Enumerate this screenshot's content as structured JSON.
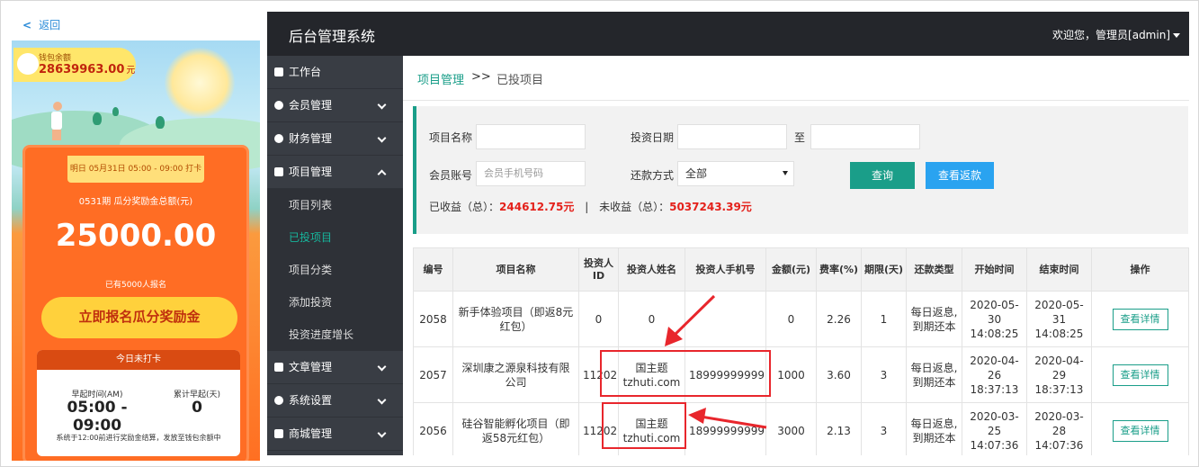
{
  "mobile": {
    "back_label": "返回",
    "wallet": {
      "label": "钱包余额",
      "amount": "28639963.00",
      "unit": "元"
    },
    "checkin_ribbon": "明日 05月31日 05:00 - 09:00 打卡",
    "round_title": "0531期 瓜分奖励金总额(元)",
    "prize_amount": "25000.00",
    "signed_count": "已有5000人报名",
    "cta_label": "立即报名瓜分奖励金",
    "today": {
      "status": "今日未打卡",
      "wake_label": "早起时间(AM)",
      "wake_value": "05:00 - 09:00",
      "total_label": "累计早起(天)",
      "total_value": "0",
      "note": "系统于12:00前进行奖励金结算，发放至钱包余额中"
    }
  },
  "admin": {
    "system_title": "后台管理系统",
    "welcome": "欢迎您，管理员[admin]",
    "sidebar": [
      {
        "label": "工作台",
        "icon": "dashboard-icon",
        "expandable": false
      },
      {
        "label": "会员管理",
        "icon": "members-icon",
        "expandable": true
      },
      {
        "label": "财务管理",
        "icon": "finance-icon",
        "expandable": true
      },
      {
        "label": "项目管理",
        "icon": "project-icon",
        "expandable": true,
        "expanded": true
      }
    ],
    "sidebar_sub": [
      "项目列表",
      "已投项目",
      "项目分类",
      "添加投资",
      "投资进度增长"
    ],
    "sidebar_rest": [
      {
        "label": "文章管理",
        "icon": "article-icon"
      },
      {
        "label": "系统设置",
        "icon": "gear-icon"
      },
      {
        "label": "商城管理",
        "icon": "shop-icon"
      }
    ],
    "breadcrumb": {
      "parent": "项目管理",
      "sep": ">>",
      "current": "已投项目"
    },
    "filter": {
      "project_name_label": "项目名称",
      "invest_date_label": "投资日期",
      "to_label": "至",
      "member_label": "会员账号",
      "member_placeholder": "会员手机号码",
      "repay_label": "还款方式",
      "repay_selected": "全部",
      "query_btn": "查询",
      "view_returns_btn": "查看返款"
    },
    "income": {
      "earned_label": "已收益（总）：",
      "earned_value": "244612.75元",
      "divider": "|",
      "pending_label": "未收益（总）：",
      "pending_value": "5037243.39元"
    },
    "table": {
      "headers": [
        "编号",
        "项目名称",
        "投资人ID",
        "投资人姓名",
        "投资人手机号",
        "金额(元)",
        "费率(%)",
        "期限(天)",
        "还款类型",
        "开始时间",
        "结束时间",
        "操作"
      ],
      "rows": [
        {
          "id": "2058",
          "name": "新手体验项目（即返8元红包）",
          "investor_id": "0",
          "investor_name": "0",
          "phone": "",
          "amount": "0",
          "rate": "2.26",
          "term": "1",
          "repay": "每日返息,到期还本",
          "start": "2020-05-30 14:08:25",
          "end": "2020-05-31 14:08:25",
          "action": "查看详情"
        },
        {
          "id": "2057",
          "name": "深圳康之源泉科技有限公司",
          "investor_id": "11202",
          "investor_name": "国主题 tzhuti.com",
          "phone": "18999999999",
          "amount": "1000",
          "rate": "3.60",
          "term": "3",
          "repay": "每日返息,到期还本",
          "start": "2020-04-26 18:37:13",
          "end": "2020-04-29 18:37:13",
          "action": "查看详情"
        },
        {
          "id": "2056",
          "name": "硅谷智能孵化项目（即返58元红包）",
          "investor_id": "11202",
          "investor_name": "国主题 tzhuti.com",
          "phone": "18999999999",
          "amount": "3000",
          "rate": "2.13",
          "term": "3",
          "repay": "每日返息,到期还本",
          "start": "2020-03-25 14:07:36",
          "end": "2020-03-28 14:07:36",
          "action": "查看详情"
        }
      ]
    },
    "colors": {
      "accent": "#1a9e89",
      "blue": "#2aa3f0",
      "topbar": "#24262b",
      "sidebar": "#393d44",
      "highlight_red": "#e8262c"
    }
  }
}
